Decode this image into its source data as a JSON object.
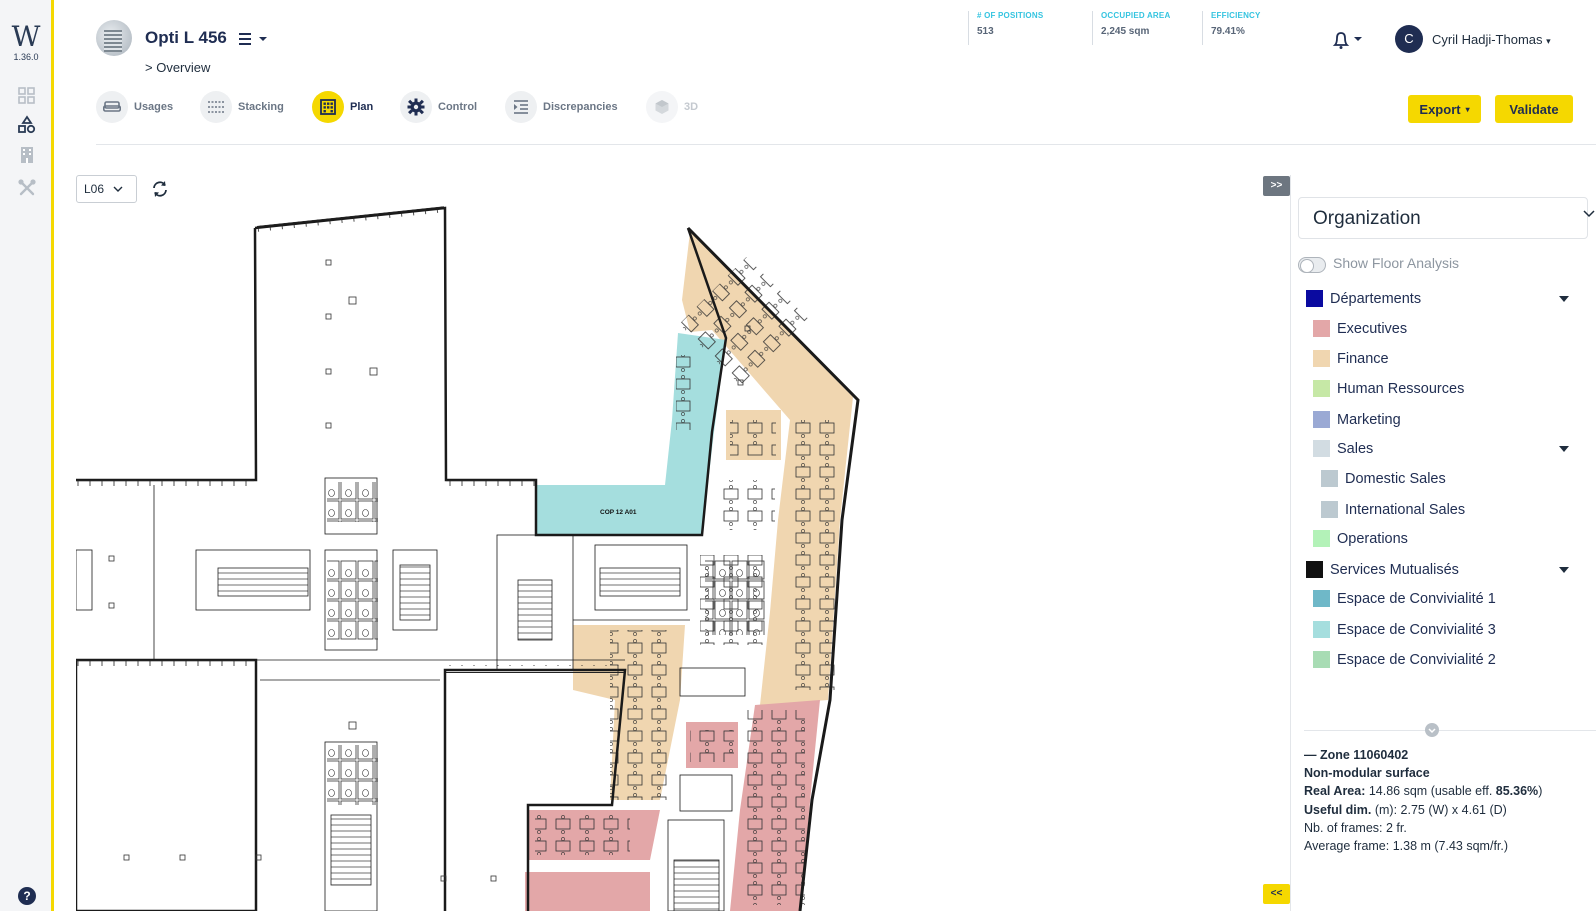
{
  "app": {
    "version": "1.36.0",
    "logo_letter": "W",
    "help": "?"
  },
  "project": {
    "title": "Opti L 456",
    "breadcrumb": "> Overview"
  },
  "kpis": [
    {
      "label": "# OF POSITIONS",
      "value": "513"
    },
    {
      "label": "OCCUPIED AREA",
      "value": "2,245 sqm"
    },
    {
      "label": "EFFICIENCY",
      "value": "79.41%"
    }
  ],
  "user": {
    "initial": "C",
    "name": "Cyril Hadji-Thomas"
  },
  "tabs": [
    {
      "label": "Usages",
      "icon": "sofa-icon"
    },
    {
      "label": "Stacking",
      "icon": "stacking-icon"
    },
    {
      "label": "Plan",
      "icon": "building-icon"
    },
    {
      "label": "Control",
      "icon": "gear-icon"
    },
    {
      "label": "Discrepancies",
      "icon": "list-indent-icon"
    },
    {
      "label": "3D",
      "icon": "cube-icon"
    }
  ],
  "actions": {
    "export": "Export",
    "validate": "Validate"
  },
  "floor": {
    "selected": "L06"
  },
  "plan": {
    "zone_label": "COP 12 A01"
  },
  "collapse": {
    "top": ">>",
    "bottom": "<<"
  },
  "panel": {
    "dropdown": "Organization",
    "toggle_label": "Show Floor Analysis",
    "legend": [
      {
        "label": "Départements",
        "color": "#0a0aa0",
        "group": true
      },
      {
        "label": "Executives",
        "color": "#e3a7a8"
      },
      {
        "label": "Finance",
        "color": "#f0d6b0"
      },
      {
        "label": "Human Ressources",
        "color": "#c6e8a6"
      },
      {
        "label": "Marketing",
        "color": "#9aa9d4"
      },
      {
        "label": "Sales",
        "color": "#d2dce2"
      },
      {
        "label": "Domestic Sales",
        "color": "#bcc9d0"
      },
      {
        "label": "International Sales",
        "color": "#bcc9d0"
      },
      {
        "label": "Operations",
        "color": "#b3f2b8"
      },
      {
        "label": "Services Mutualisés",
        "color": "#111111",
        "group": true
      },
      {
        "label": "Espace de Convivialité 1",
        "color": "#6fb8c8"
      },
      {
        "label": "Espace de Convivialité 3",
        "color": "#a5dede"
      },
      {
        "label": "Espace de Convivialité 2",
        "color": "#a8dcb4"
      }
    ],
    "details": {
      "zone": "— Zone 11060402",
      "surface": "Non-modular surface",
      "real_area_label": "Real Area:",
      "real_area_value": " 14.86 sqm (usable eff. ",
      "usable_eff": "85.36%",
      "real_area_close": ")",
      "useful_label": "Useful dim.",
      "useful_value": " (m): 2.75 (W) x 4.61 (D)",
      "frames": "Nb. of frames: 2 fr.",
      "avg_frame": "Average frame: 1.38 m (7.43 sqm/fr.)"
    }
  }
}
